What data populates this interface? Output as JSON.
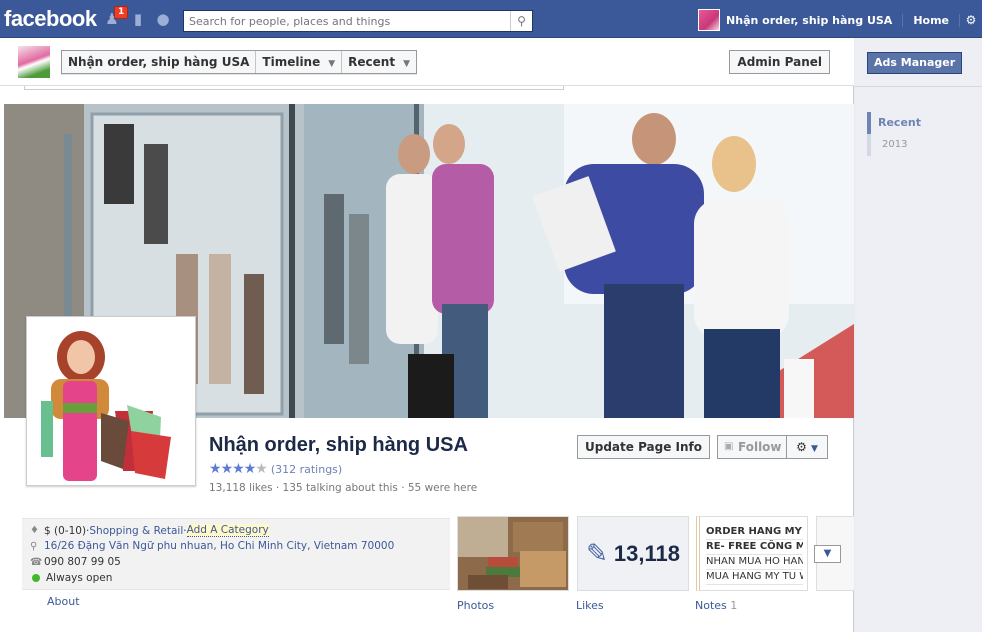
{
  "topbar": {
    "logo": "facebook",
    "notification_count": "1",
    "search_placeholder": "Search for people, places and things",
    "page_name": "Nhận order, ship hàng USA",
    "home": "Home"
  },
  "pagebar": {
    "crumbs": [
      "Nhận order, ship hàng USA",
      "Timeline",
      "Recent"
    ],
    "admin_panel": "Admin Panel"
  },
  "profile": {
    "name": "Nhận order, ship hàng USA",
    "rating_stars": 4,
    "ratings_text": "(312 ratings)",
    "stats": "13,118 likes · 135 talking about this · 55 were here",
    "update_info": "Update Page Info",
    "follow": "Follow"
  },
  "info": {
    "price": "$ (0-10)",
    "sep": " · ",
    "category": "Shopping & Retail",
    "add_category": "Add A Category",
    "address": "16/26 Đặng Văn Ngữ phu nhuan, Ho Chi Minh City, Vietnam 70000",
    "phone": "090 807 99 05",
    "hours": "Always open",
    "about": "About"
  },
  "apps": {
    "photos_label": "Photos",
    "likes_count": "13,118",
    "likes_label": "Likes",
    "notes_label": "Notes",
    "notes_count": "1",
    "notes_lines": [
      "ORDER HANG MY CI",
      "RE- FREE CÔNG MU",
      "NHAN MUA HO HANG",
      "MUA HANG MY TU WI"
    ]
  },
  "right": {
    "ads_manager": "Ads Manager",
    "timeline_current": "Recent",
    "timeline_year": "2013"
  },
  "colors": {
    "brand": "#3b5998",
    "link": "#3b5998",
    "status_open": "#42b72a"
  },
  "icons": [
    "friends-icon",
    "messages-icon",
    "globe-icon",
    "search-icon",
    "gear-icon",
    "tag-icon",
    "location-pin-icon",
    "phone-icon",
    "like-thumb-icon",
    "rss-icon",
    "chevron-down-icon"
  ]
}
